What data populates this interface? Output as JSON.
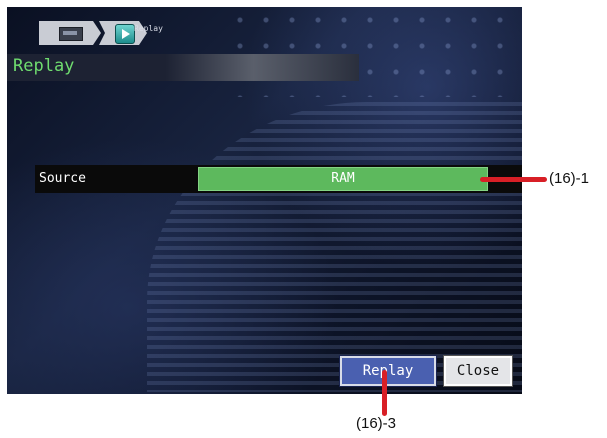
{
  "breadcrumb": {
    "items": [
      {
        "icon": "menu-screen-icon"
      },
      {
        "icon": "replay-play-icon",
        "label": "Replay"
      }
    ]
  },
  "page": {
    "title": "Replay"
  },
  "source": {
    "label": "Source",
    "value": "RAM"
  },
  "buttons": {
    "replay": "Replay",
    "close": "Close"
  },
  "callouts": {
    "source": "(16)-1",
    "replay": "(16)-3"
  },
  "colors": {
    "title": "#6fdc6f",
    "source_value_bg": "#5db95d",
    "replay_button": "#4a60b0",
    "callout": "#d81f26"
  }
}
